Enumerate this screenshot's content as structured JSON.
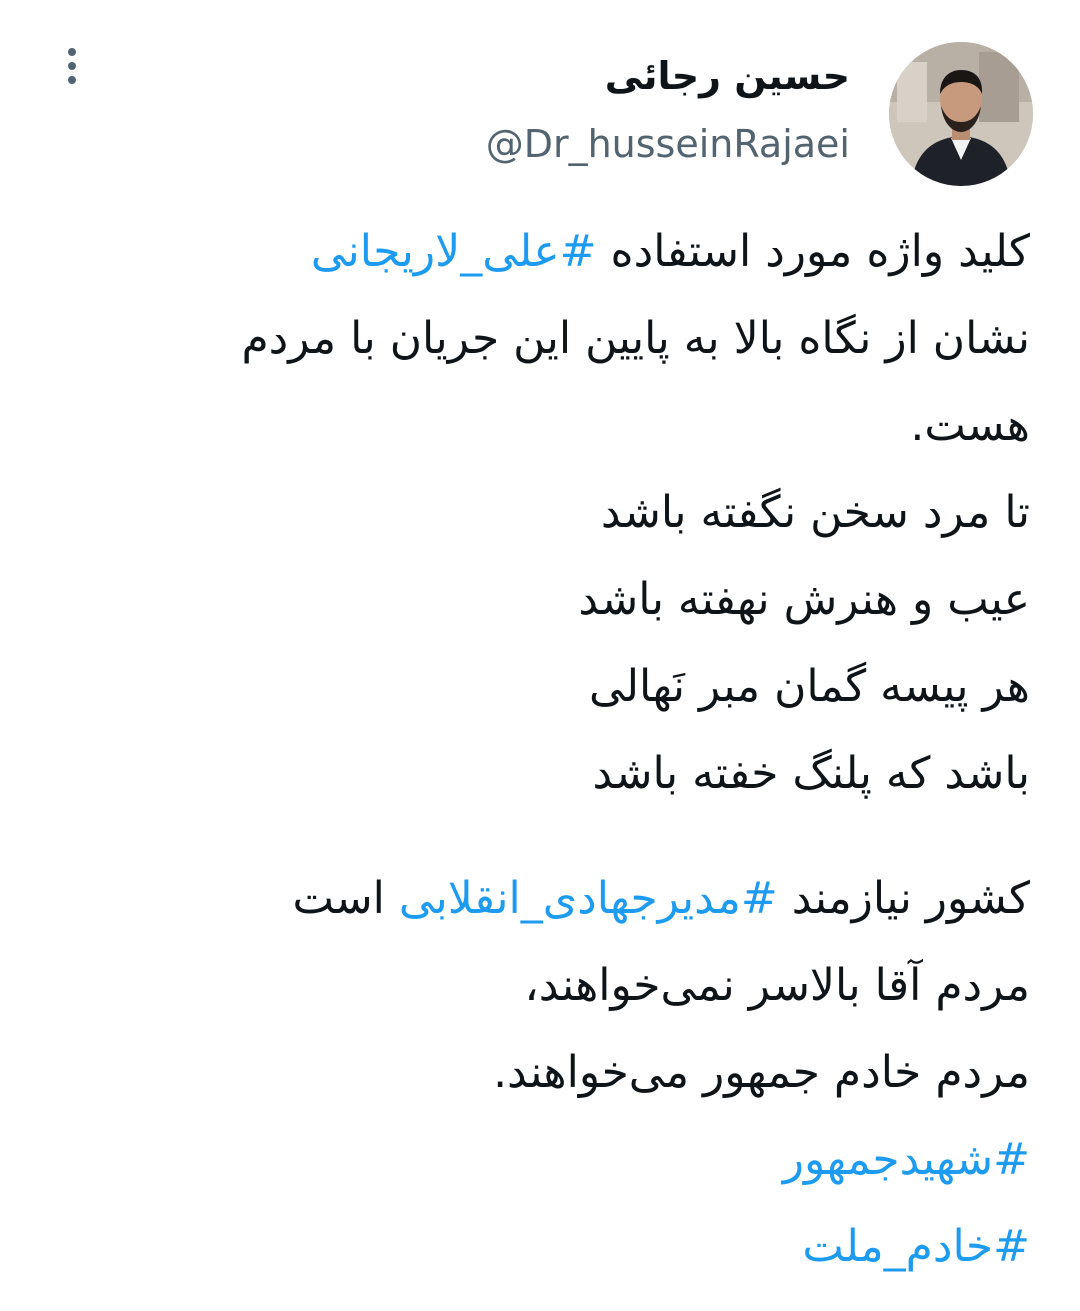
{
  "tweet": {
    "author": {
      "name": "حسین رجائی",
      "handle": "@Dr_husseinRajaei",
      "avatar_icon": "profile-photo-icon"
    },
    "more_icon": "more-options-icon",
    "body": {
      "p1_l1_text": "کلید واژه مورد استفاده ",
      "p1_l1_hashtag": "#علی_لاریجانی",
      "p1_l2": "نشان از نگاه بالا به پایین این جریان با مردم",
      "p1_l3": "هست.",
      "p1_l4": "تا مرد سخن نگفته باشد",
      "p1_l5": "عیب و هنرش نهفته باشد",
      "p1_l6": "هر پیسه گمان مبر نَهالی",
      "p1_l7": "باشد که پلنگ خفته باشد",
      "p2_l1_text_a": "کشور نیازمند ",
      "p2_l1_hashtag": "#مدیرجهادی_انقلابی",
      "p2_l1_text_b": " است",
      "p2_l2": "مردم آقا بالاسر نمی‌خواهند،",
      "p2_l3": "مردم خادم جمهور می‌خواهند.",
      "hashtag_1": "#شهیدجمهور",
      "hashtag_2": "#خادم_ملت"
    },
    "colors": {
      "text": "#0f1419",
      "secondary": "#536471",
      "link": "#1d9bf0",
      "background": "#ffffff"
    }
  }
}
